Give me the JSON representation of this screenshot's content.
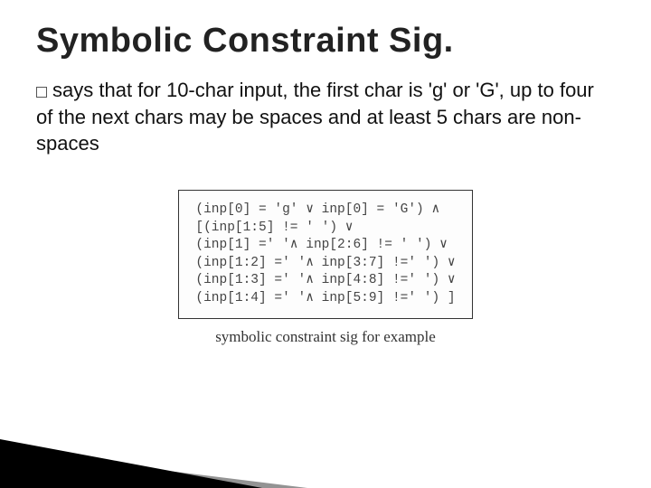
{
  "title": "Symbolic Constraint Sig.",
  "bullet_prefix": "says",
  "body_rest": " that for 10-char input, the first char is 'g' or 'G', up to four of the next chars may be spaces and at least 5 chars are non-spaces",
  "constraint_lines": [
    "(inp[0] = 'g' ∨ inp[0] = 'G') ∧",
    "[(inp[1:5] != ' ') ∨",
    "(inp[1] =' '∧ inp[2:6] != ' ') ∨",
    "(inp[1:2] =' '∧ inp[3:7] !=' ') ∨",
    "(inp[1:3] =' '∧ inp[4:8] !=' ') ∨",
    "(inp[1:4] =' '∧ inp[5:9] !=' ') ]"
  ],
  "caption": "symbolic constraint sig for example"
}
